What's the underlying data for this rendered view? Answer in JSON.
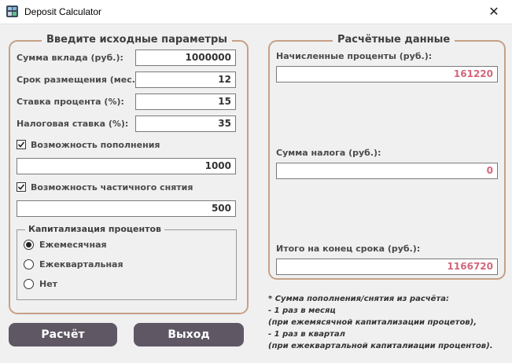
{
  "window": {
    "title": "Deposit Calculator",
    "close_glyph": "✕",
    "icon": "calculator-icon"
  },
  "input_group": {
    "title": "Введите исходные параметры",
    "fields": [
      {
        "label": "Сумма вклада (руб.):",
        "value": "1000000"
      },
      {
        "label": "Срок размещения (мес.):",
        "value": "12"
      },
      {
        "label": "Ставка процента (%):",
        "value": "15"
      },
      {
        "label": "Налоговая ставка (%):",
        "value": "35"
      }
    ],
    "replenish": {
      "label": "Возможность пополнения",
      "checked": true,
      "value": "1000"
    },
    "withdraw": {
      "label": "Возможность частичного снятия",
      "checked": true,
      "value": "500"
    },
    "capitalization": {
      "title": "Капитализация процентов",
      "options": [
        {
          "label": "Ежемесячная",
          "selected": true
        },
        {
          "label": "Ежеквартальная",
          "selected": false
        },
        {
          "label": "Нет",
          "selected": false
        }
      ]
    }
  },
  "results_group": {
    "title": "Расчётные данные",
    "accrued": {
      "label": "Начисленные проценты (руб.):",
      "value": "161220"
    },
    "tax": {
      "label": "Сумма налога (руб.):",
      "value": "0"
    },
    "total": {
      "label": "Итого на конец срока (руб.):",
      "value": "1166720"
    }
  },
  "buttons": {
    "calculate": "Расчёт",
    "exit": "Выход"
  },
  "note": [
    "* Сумма пополнения/снятия из расчёта:",
    "- 1 раз в месяц",
    "(при ежемясячной капитализации процетов),",
    "- 1 раз в квартал",
    "(при ежеквартальной капиталиации процентов)."
  ],
  "colors": {
    "group_border": "#c6a086",
    "button_bg": "#5f5864",
    "output_text": "#d2667c",
    "window_bg": "#f0f0f0"
  }
}
